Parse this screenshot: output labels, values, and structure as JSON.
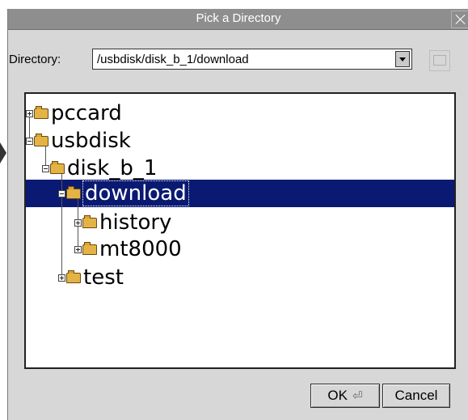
{
  "window": {
    "title": "Pick a Directory"
  },
  "directory": {
    "label": "Directory:",
    "value": "/usbdisk/disk_b_1/download"
  },
  "tree": {
    "nodes": [
      {
        "label": "pccard",
        "expanded": false
      },
      {
        "label": "usbdisk",
        "expanded": true
      },
      {
        "label": "disk_b_1",
        "expanded": true
      },
      {
        "label": "download",
        "expanded": true,
        "selected": true
      },
      {
        "label": "history",
        "expanded": false
      },
      {
        "label": "mt8000",
        "expanded": false
      },
      {
        "label": "test",
        "expanded": false
      }
    ]
  },
  "buttons": {
    "ok_label": "OK",
    "ok_icon": "enter-key-icon",
    "cancel_label": "Cancel"
  },
  "colors": {
    "selection": "#0a1a72",
    "title_bar": "#8e8e8e",
    "dialog_bg": "#d7d7d7"
  }
}
